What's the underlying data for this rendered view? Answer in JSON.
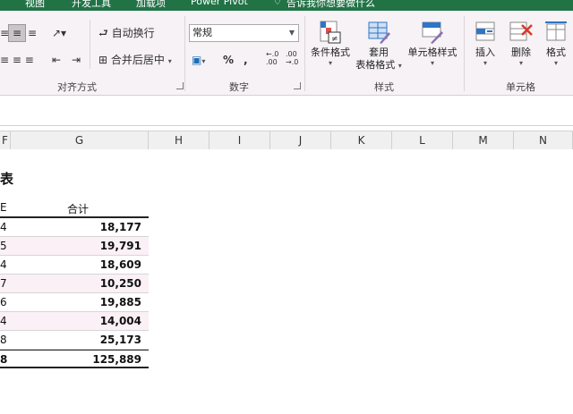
{
  "menubar": {
    "items": [
      "视图",
      "开发工具",
      "加载项",
      "Power Pivot",
      "告诉我你想要做什么"
    ],
    "bg": "#217346"
  },
  "ribbon": {
    "alignment": {
      "label": "对齐方式",
      "wrap_text": "自动换行",
      "merge_center": "合并后居中"
    },
    "number": {
      "label": "数字",
      "format_value": "常规",
      "percent": "%",
      "comma": ",",
      "inc_decimal": "←.0\n.00",
      "dec_decimal": ".00\n→.0"
    },
    "styles": {
      "label": "样式",
      "conditional": "条件格式",
      "table_format_1": "套用",
      "table_format_2": "表格格式",
      "cell_styles": "单元格样式"
    },
    "cells": {
      "label": "单元格",
      "insert": "插入",
      "delete": "删除",
      "format": "格式"
    }
  },
  "columns": [
    "F",
    "G",
    "H",
    "I",
    "J",
    "K",
    "L",
    "M",
    "N"
  ],
  "sheet": {
    "title": "表",
    "header_left": "E",
    "header_total": "合计",
    "rows": [
      {
        "k": "4",
        "v": "18,177"
      },
      {
        "k": "5",
        "v": "19,791"
      },
      {
        "k": "4",
        "v": "18,609"
      },
      {
        "k": "7",
        "v": "10,250"
      },
      {
        "k": "6",
        "v": "19,885"
      },
      {
        "k": "4",
        "v": "14,004"
      },
      {
        "k": "8",
        "v": "25,173"
      },
      {
        "k": "8",
        "v": "125,889"
      }
    ]
  }
}
